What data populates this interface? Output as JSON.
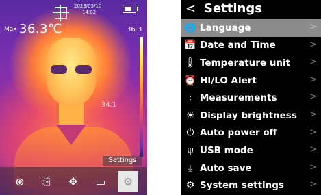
{
  "thermal": {
    "max_label": "Max",
    "max_value": "36.3℃",
    "scale_top": "36.3",
    "mid_temp": "34.1",
    "date": "2023/05/10",
    "time": "14:02",
    "settings_tag": "Settings",
    "dock_icons": [
      "target-icon",
      "flash-icon",
      "move-icon",
      "image-icon",
      "settings-gear-icon"
    ]
  },
  "settings": {
    "back_glyph": "<",
    "title": "Settings",
    "items": [
      {
        "label": "Language",
        "icon": "globe-icon",
        "glyph": "🌐",
        "selected": true
      },
      {
        "label": "Date and Time",
        "icon": "calendar-clock-icon",
        "glyph": "📅"
      },
      {
        "label": "Temperature unit",
        "icon": "thermometer-icon",
        "glyph": "🌡"
      },
      {
        "label": "HI/LO Alert",
        "icon": "alarm-icon",
        "glyph": "⏰"
      },
      {
        "label": "Measurements",
        "icon": "sliders-icon",
        "glyph": "⫶"
      },
      {
        "label": "Display brightness",
        "icon": "brightness-icon",
        "glyph": "☀"
      },
      {
        "label": "Auto power off",
        "icon": "power-icon",
        "glyph": "⏻"
      },
      {
        "label": "USB mode",
        "icon": "usb-icon",
        "glyph": "ψ"
      },
      {
        "label": "Auto save",
        "icon": "download-icon",
        "glyph": "⤓"
      },
      {
        "label": "System settings",
        "icon": "gear-icon",
        "glyph": "⚙"
      }
    ],
    "chevron": ">"
  }
}
